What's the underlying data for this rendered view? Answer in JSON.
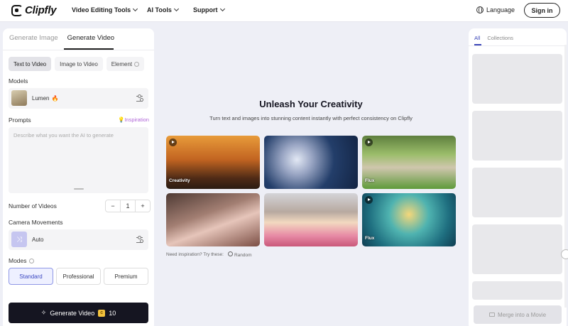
{
  "brand": {
    "name": "Clipfly"
  },
  "nav": {
    "items": [
      "Video Editing Tools",
      "AI Tools",
      "Support"
    ],
    "language": "Language",
    "signin": "Sign in"
  },
  "left": {
    "gen_tabs": [
      "Generate Image",
      "Generate Video"
    ],
    "mode_tabs": [
      "Text to Video",
      "Image to Video",
      "Element"
    ],
    "models_label": "Models",
    "model_name": "Lumen",
    "prompts_label": "Prompts",
    "inspiration": "Inspiration",
    "prompt_placeholder": "Describe what you want the AI to generate",
    "num_videos_label": "Number of Videos",
    "stepper": {
      "minus": "−",
      "value": "1",
      "plus": "+"
    },
    "camera_label": "Camera Movements",
    "camera_value": "Auto",
    "modes_label": "Modes",
    "levels": [
      "Standard",
      "Professional",
      "Premium"
    ],
    "generate_label": "Generate Video",
    "credits": "10"
  },
  "center": {
    "title": "Unleash Your Creativity",
    "subtitle": "Turn text and images into stunning content instantly with perfect consistency on Clipfly",
    "cards": [
      {
        "label": "Creativity"
      },
      {
        "label": ""
      },
      {
        "label": "Flux"
      },
      {
        "label": ""
      },
      {
        "label": ""
      },
      {
        "label": "Flux"
      }
    ],
    "need_inspiration": "Need inspiration? Try these:",
    "random": "Random"
  },
  "right": {
    "tabs": [
      "All",
      "Collections"
    ],
    "merge": "Merge into a Movie"
  }
}
